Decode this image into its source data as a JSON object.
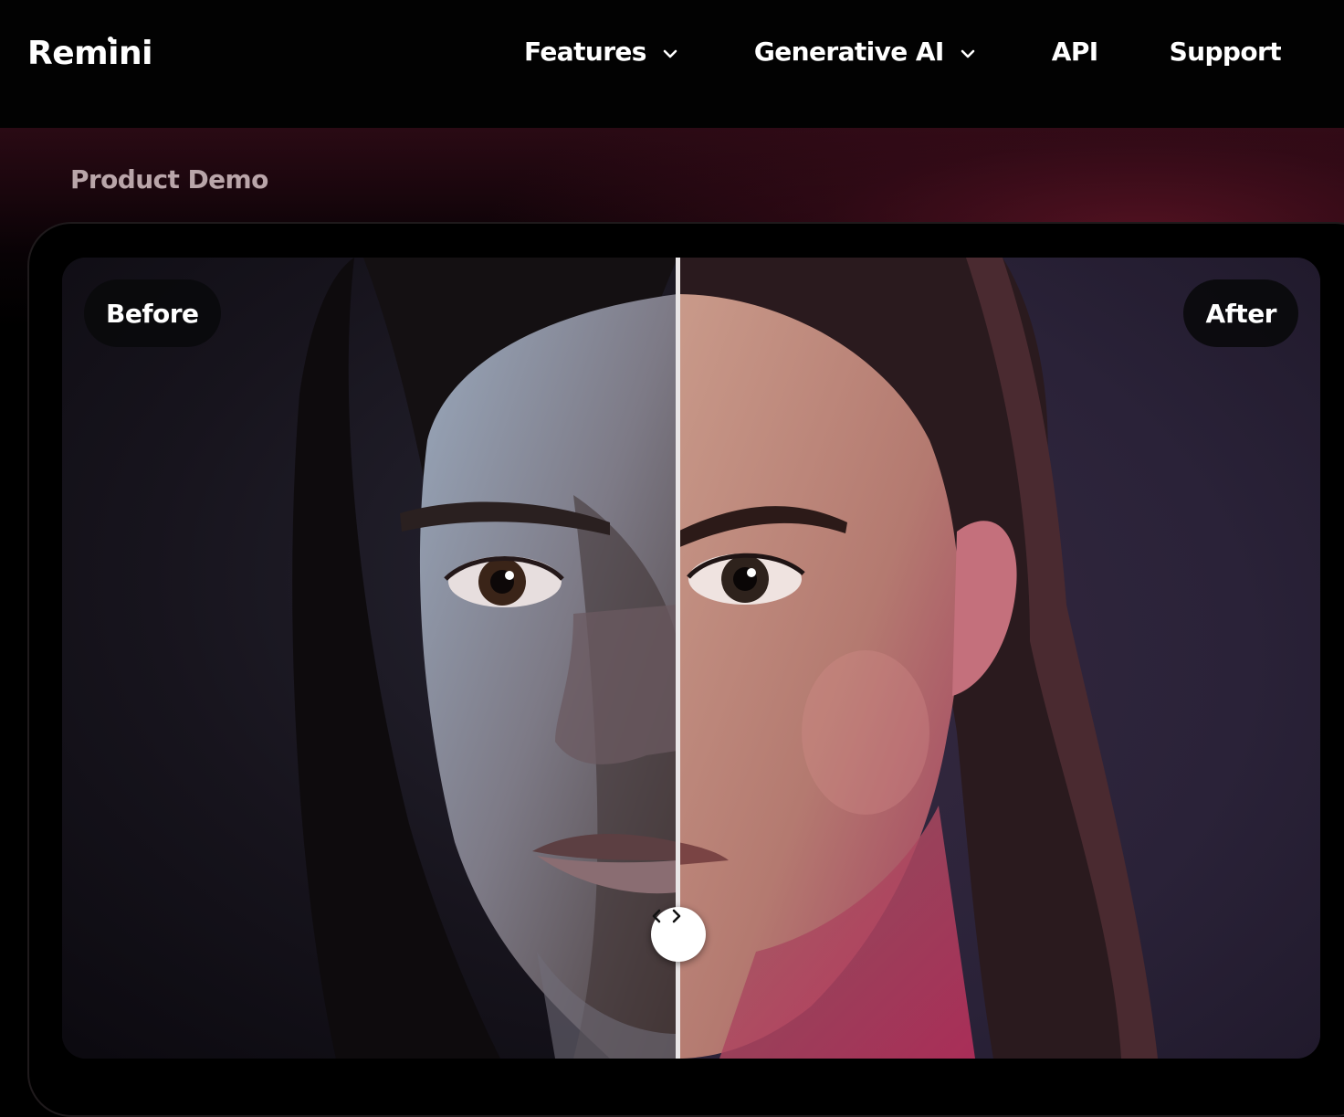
{
  "brand": {
    "name": "Remini"
  },
  "nav": {
    "items": [
      {
        "label": "Features",
        "has_dropdown": true
      },
      {
        "label": "Generative AI",
        "has_dropdown": true
      },
      {
        "label": "API",
        "has_dropdown": false
      },
      {
        "label": "Support",
        "has_dropdown": false
      }
    ]
  },
  "section": {
    "title": "Product Demo"
  },
  "compare": {
    "before_label": "Before",
    "after_label": "After",
    "slider_position": 0.49,
    "handle_icon": "chevrons-left-right-icon"
  },
  "colors": {
    "background": "#000000",
    "accent_band": "#5f1426",
    "section_title": "#b9a5a9",
    "pill_bg": "#0a0a0c",
    "divider": "#e9e6e7"
  }
}
